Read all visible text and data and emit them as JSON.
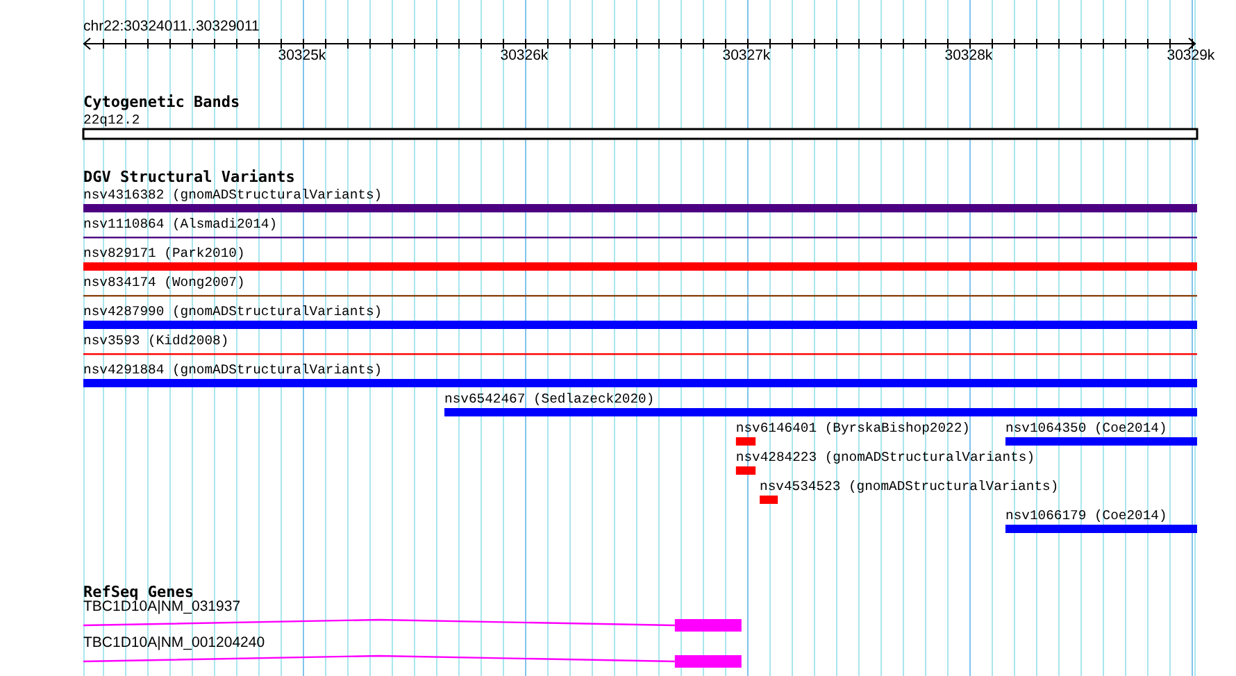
{
  "ruler": {
    "title": "chr22:30324011..30329011",
    "ticks": [
      {
        "label": "30325k"
      },
      {
        "label": "30326k"
      },
      {
        "label": "30327k"
      },
      {
        "label": "30328k"
      },
      {
        "label": "30329k"
      }
    ]
  },
  "tracks": [
    {
      "kind": "cytoband",
      "title": "Cytogenetic Bands",
      "bands": [
        {
          "label": "22q12.2"
        }
      ]
    },
    {
      "kind": "variants",
      "title": "DGV Structural Variants",
      "rows": [
        {
          "features": [
            {
              "label": "nsv4316382 (gnomADStructuralVariants)",
              "kind": "thick",
              "color": "#4b0082"
            }
          ]
        },
        {
          "features": [
            {
              "label": "nsv1110864 (Alsmadi2014)",
              "kind": "thin",
              "color": "#4b0082"
            }
          ]
        },
        {
          "features": [
            {
              "label": "nsv829171 (Park2010)",
              "kind": "thick",
              "color": "#ff0000"
            }
          ]
        },
        {
          "features": [
            {
              "label": "nsv834174 (Wong2007)",
              "kind": "thin",
              "color": "#8b4513"
            }
          ]
        },
        {
          "features": [
            {
              "label": "nsv4287990 (gnomADStructuralVariants)",
              "kind": "thick",
              "color": "#0000ff"
            }
          ]
        },
        {
          "features": [
            {
              "label": "nsv3593 (Kidd2008)",
              "kind": "thin",
              "color": "#ff0000"
            }
          ]
        },
        {
          "features": [
            {
              "label": "nsv4291884 (gnomADStructuralVariants)",
              "kind": "thick",
              "color": "#0000ff"
            }
          ]
        },
        {
          "features": [
            {
              "label": "nsv6542467 (Sedlazeck2020)",
              "kind": "thick",
              "color": "#0000ff"
            }
          ]
        },
        {
          "features": [
            {
              "label": "nsv6146401 (ByrskaBishop2022)",
              "kind": "thick",
              "color": "#ff0000"
            },
            {
              "label": "nsv1064350 (Coe2014)",
              "kind": "thick",
              "color": "#0000ff"
            }
          ]
        },
        {
          "features": [
            {
              "label": "nsv4284223 (gnomADStructuralVariants)",
              "kind": "thick",
              "color": "#ff0000"
            }
          ]
        },
        {
          "features": [
            {
              "label": "nsv4534523 (gnomADStructuralVariants)",
              "kind": "thick",
              "color": "#ff0000"
            }
          ]
        },
        {
          "features": [
            {
              "label": "nsv1066179 (Coe2014)",
              "kind": "thick",
              "color": "#0000ff"
            }
          ]
        }
      ]
    },
    {
      "kind": "genes",
      "title": "RefSeq Genes",
      "genes": [
        {
          "label": "TBC1D10A|NM_031937"
        },
        {
          "label": "TBC1D10A|NM_001204240"
        }
      ]
    }
  ]
}
